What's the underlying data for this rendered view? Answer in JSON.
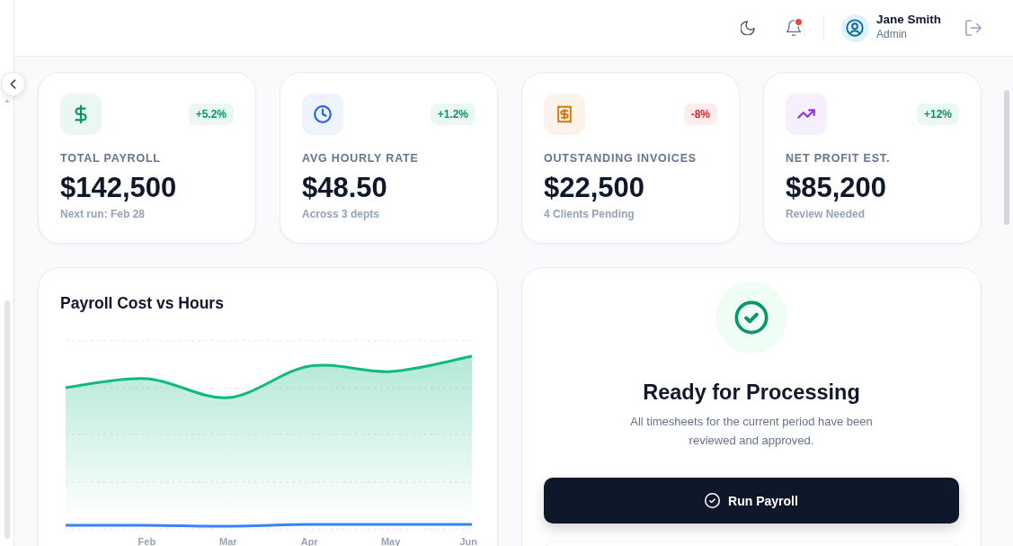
{
  "header": {
    "unread_notifications": true,
    "user": {
      "name": "Jane Smith",
      "role": "Admin"
    }
  },
  "stats": [
    {
      "label": "TOTAL PAYROLL",
      "value": "$142,500",
      "note": "Next run: Feb 28",
      "change": {
        "text": "+5.2%",
        "color": "#059669"
      },
      "color": "#059669"
    },
    {
      "label": "AVG HOURLY RATE",
      "value": "$48.50",
      "note": "Across 3 depts",
      "change": {
        "text": "+1.2%",
        "color": "#059669"
      },
      "color": "#2563eb"
    },
    {
      "label": "OUTSTANDING INVOICES",
      "value": "$22,500",
      "note": "4 Clients Pending",
      "change": {
        "text": "-8%",
        "color": "#dc2626"
      },
      "color": "#d97706"
    },
    {
      "label": "NET PROFIT EST.",
      "value": "$85,200",
      "note": "Review Needed",
      "change": {
        "text": "+12%",
        "color": "#059669"
      },
      "color": "#9333ea"
    }
  ],
  "chart": {
    "title": "Payroll Cost vs Hours",
    "x_labels": [
      "Feb",
      "Mar",
      "Apr",
      "May",
      "Jun"
    ]
  },
  "status_panel": {
    "title": "Ready for Processing",
    "description": "All timesheets for the current period have been reviewed and approved.",
    "button": "Run Payroll"
  }
}
